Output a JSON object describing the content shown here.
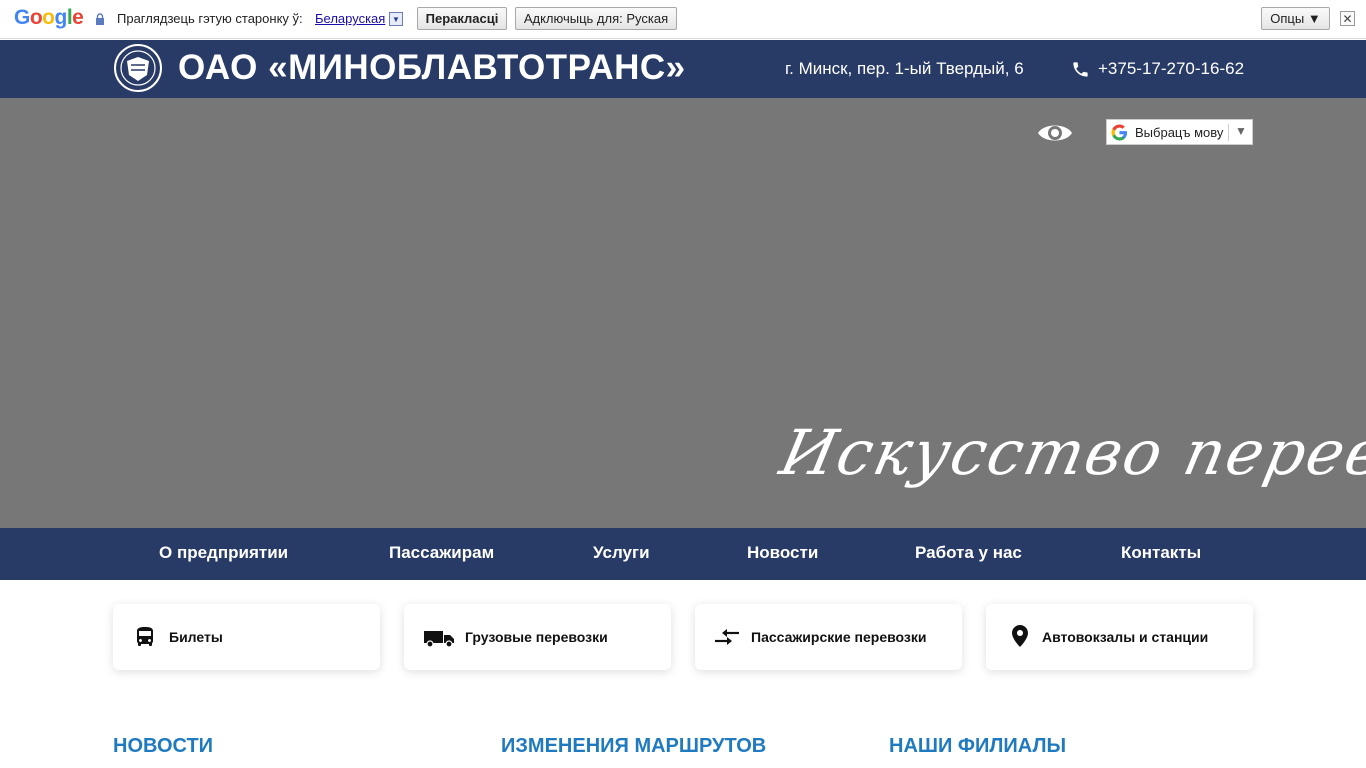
{
  "translate_bar": {
    "logo": "Google",
    "prompt": "Праглядзець гэтую старонку ў:",
    "language": "Беларуская",
    "translate_button": "Перакласці",
    "turn_off_button": "Адключыць для: Руская",
    "options_button": "Опцы ▼",
    "close": "✕"
  },
  "header": {
    "title": "ОАО «МИНОБЛАВТОТРАНС»",
    "address": "г. Минск, пер. 1-ый Твердый, 6",
    "phone": "+375-17-270-16-62",
    "brand_color": "#283a66"
  },
  "hero": {
    "language_select": "Выбрацъ мову",
    "slogan": "Искусство перевозок",
    "background": "#777777"
  },
  "nav": {
    "items": [
      "О предприятии",
      "Пассажирам",
      "Услуги",
      "Новости",
      "Работа у нас",
      "Контакты"
    ]
  },
  "cards": [
    {
      "label": "Билеты",
      "icon": "bus-icon"
    },
    {
      "label": "Грузовые перевозки",
      "icon": "truck-icon"
    },
    {
      "label": "Пассажирские перевозки",
      "icon": "exchange-arrows-icon"
    },
    {
      "label": "Автовокзалы и станции",
      "icon": "map-pin-icon"
    }
  ],
  "sections": {
    "news": "НОВОСТИ",
    "route_changes": "ИЗМЕНЕНИЯ МАРШРУТОВ",
    "branches": "НАШИ ФИЛИАЛЫ",
    "accent_color": "#1f7ac0"
  }
}
